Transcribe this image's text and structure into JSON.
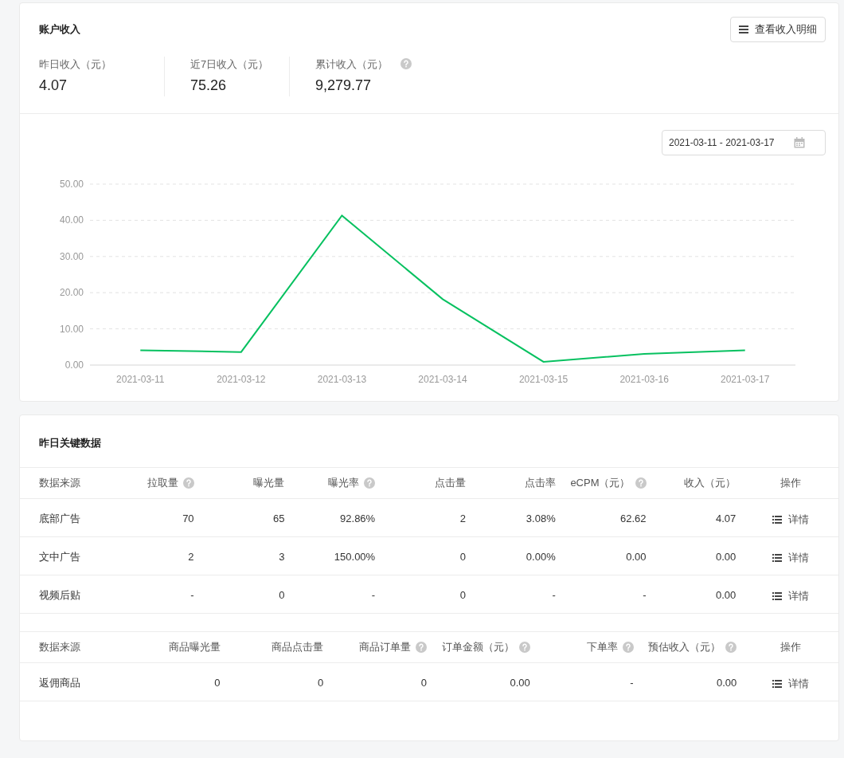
{
  "account_income": {
    "title": "账户收入",
    "detail_button": "查看收入明细",
    "stats": [
      {
        "label": "昨日收入（元）",
        "value": "4.07",
        "help": false
      },
      {
        "label": "近7日收入（元）",
        "value": "75.26",
        "help": false
      },
      {
        "label": "累计收入（元）",
        "value": "9,279.77",
        "help": true
      }
    ],
    "date_range": "2021-03-11 - 2021-03-17",
    "chart_data": {
      "type": "line",
      "categories": [
        "2021-03-11",
        "2021-03-12",
        "2021-03-13",
        "2021-03-14",
        "2021-03-15",
        "2021-03-16",
        "2021-03-17"
      ],
      "series": [
        {
          "color": "#07c160",
          "values": [
            4.1,
            3.6,
            41.3,
            18.2,
            0.9,
            3.1,
            4.1
          ]
        }
      ],
      "ylim": [
        0,
        50
      ],
      "grid": true,
      "yticks": [
        {
          "value": 0,
          "label": "0.00"
        },
        {
          "value": 10,
          "label": "10.00"
        },
        {
          "value": 20,
          "label": "20.00"
        },
        {
          "value": 30,
          "label": "30.00"
        },
        {
          "value": 40,
          "label": "40.00"
        },
        {
          "value": 50,
          "label": "50.00"
        }
      ]
    }
  },
  "key_data": {
    "title": "昨日关键数据",
    "tables": [
      {
        "columns": [
          {
            "label": "数据来源",
            "help": false
          },
          {
            "label": "拉取量",
            "help": true
          },
          {
            "label": "曝光量",
            "help": false
          },
          {
            "label": "曝光率",
            "help": true
          },
          {
            "label": "点击量",
            "help": false
          },
          {
            "label": "点击率",
            "help": false
          },
          {
            "label": "eCPM（元）",
            "help": true
          },
          {
            "label": "收入（元）",
            "help": false
          },
          {
            "label": "操作",
            "help": false
          }
        ],
        "rows": [
          {
            "cells": [
              "底部广告",
              "70",
              "65",
              "92.86%",
              "2",
              "3.08%",
              "62.62",
              "4.07"
            ],
            "action": "详情"
          },
          {
            "cells": [
              "文中广告",
              "2",
              "3",
              "150.00%",
              "0",
              "0.00%",
              "0.00",
              "0.00"
            ],
            "action": "详情"
          },
          {
            "cells": [
              "视频后贴",
              "-",
              "0",
              "-",
              "0",
              "-",
              "-",
              "0.00"
            ],
            "action": "详情"
          }
        ]
      },
      {
        "columns": [
          {
            "label": "数据来源",
            "help": false
          },
          {
            "label": "商品曝光量",
            "help": false
          },
          {
            "label": "商品点击量",
            "help": false
          },
          {
            "label": "商品订单量",
            "help": true
          },
          {
            "label": "订单金额（元）",
            "help": true
          },
          {
            "label": "下单率",
            "help": true
          },
          {
            "label": "预估收入（元）",
            "help": true
          },
          {
            "label": "操作",
            "help": false
          }
        ],
        "rows": [
          {
            "cells": [
              "返佣商品",
              "0",
              "0",
              "0",
              "0.00",
              "-",
              "0.00"
            ],
            "action": "详情"
          }
        ]
      }
    ]
  }
}
